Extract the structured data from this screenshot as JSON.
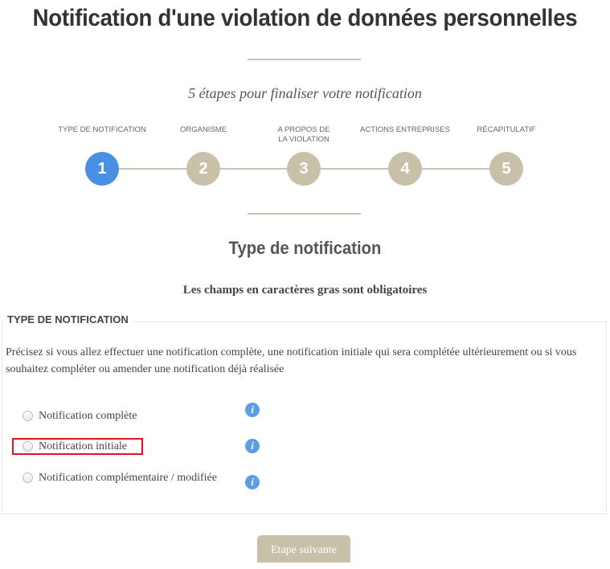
{
  "page": {
    "title": "Notification d'une violation de données personnelles",
    "subtitle": "5 étapes pour finaliser votre notification"
  },
  "steps": [
    {
      "number": "1",
      "label": "TYPE DE NOTIFICATION",
      "active": true
    },
    {
      "number": "2",
      "label": "ORGANISME",
      "active": false
    },
    {
      "number": "3",
      "label": "A PROPOS DE LA VIOLATION",
      "active": false
    },
    {
      "number": "4",
      "label": "ACTIONS ENTREPRISES",
      "active": false
    },
    {
      "number": "5",
      "label": "RÉCAPITULATIF",
      "active": false
    }
  ],
  "section": {
    "title": "Type de notification",
    "required_note": "Les champs en caractères gras sont obligatoires"
  },
  "fieldset": {
    "legend": "TYPE DE NOTIFICATION",
    "description": "Précisez si vous allez effectuer une notification complète, une notification initiale qui sera complétée ultérieurement ou si vous souhaitez compléter ou amender une notification déjà réalisée",
    "options": [
      {
        "label": "Notification complète",
        "selected": false
      },
      {
        "label": "Notification initiale",
        "selected": false
      },
      {
        "label": "Notification complémentaire / modifiée",
        "selected": false
      }
    ],
    "info_icon_glyph": "i"
  },
  "footer": {
    "next_label": "Etape suivante"
  },
  "colors": {
    "active_step": "#4a90e2",
    "inactive_step": "#c9c0a8",
    "highlight": "#e3101f",
    "info_icon": "#5b9ee6"
  }
}
